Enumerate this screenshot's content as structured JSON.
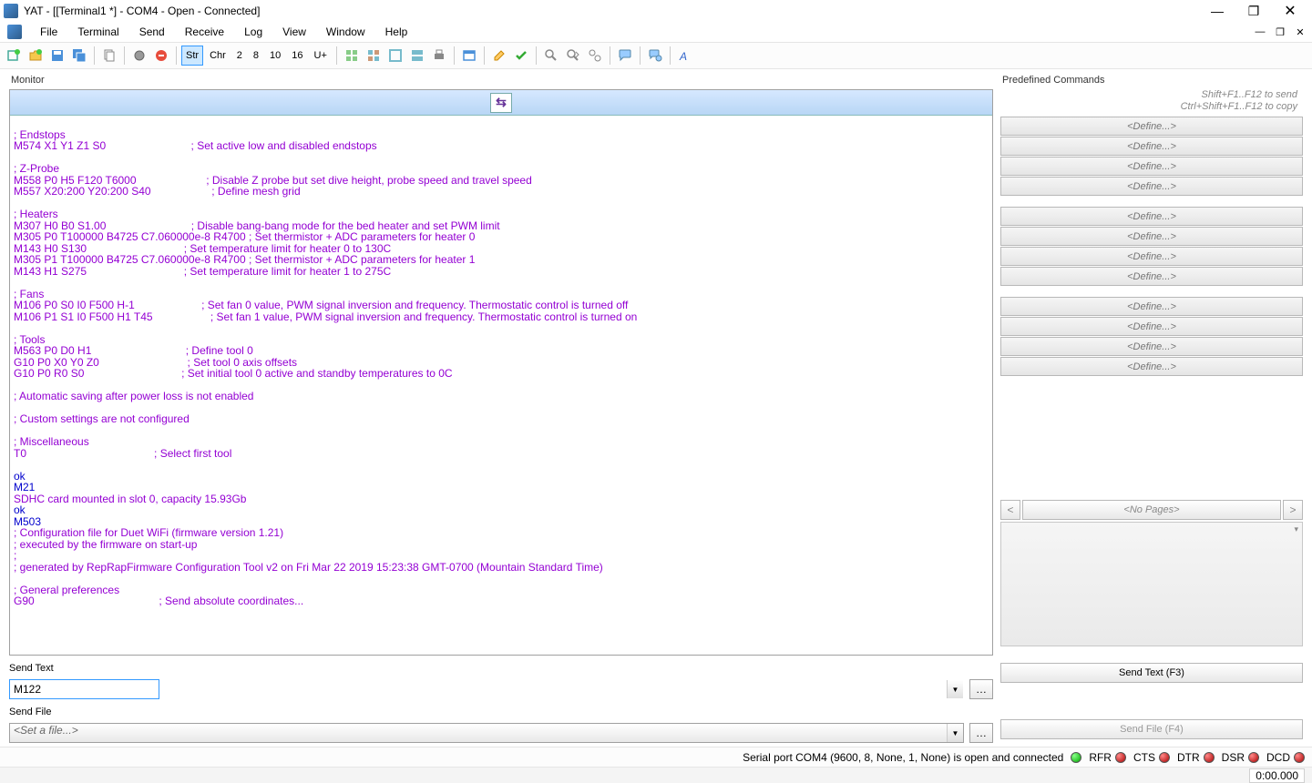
{
  "window": {
    "title": "YAT - [[Terminal1 *] - COM4 - Open - Connected]"
  },
  "menu": {
    "items": [
      "File",
      "Terminal",
      "Send",
      "Receive",
      "Log",
      "View",
      "Window",
      "Help"
    ]
  },
  "toolbar": {
    "radix": {
      "str": "Str",
      "chr": "Chr",
      "r2": "2",
      "r8": "8",
      "r10": "10",
      "r16": "16",
      "uplus": "U+"
    }
  },
  "monitor": {
    "label": "Monitor",
    "lines": [
      {
        "c": "p",
        "t": ""
      },
      {
        "c": "p",
        "t": "; Endstops"
      },
      {
        "c": "p",
        "t": "M574 X1 Y1 Z1 S0                            ; Set active low and disabled endstops"
      },
      {
        "c": "p",
        "t": ""
      },
      {
        "c": "p",
        "t": "; Z-Probe"
      },
      {
        "c": "p",
        "t": "M558 P0 H5 F120 T6000                       ; Disable Z probe but set dive height, probe speed and travel speed"
      },
      {
        "c": "p",
        "t": "M557 X20:200 Y20:200 S40                    ; Define mesh grid"
      },
      {
        "c": "p",
        "t": ""
      },
      {
        "c": "p",
        "t": "; Heaters"
      },
      {
        "c": "p",
        "t": "M307 H0 B0 S1.00                            ; Disable bang-bang mode for the bed heater and set PWM limit"
      },
      {
        "c": "p",
        "t": "M305 P0 T100000 B4725 C7.060000e-8 R4700 ; Set thermistor + ADC parameters for heater 0"
      },
      {
        "c": "p",
        "t": "M143 H0 S130                                ; Set temperature limit for heater 0 to 130C"
      },
      {
        "c": "p",
        "t": "M305 P1 T100000 B4725 C7.060000e-8 R4700 ; Set thermistor + ADC parameters for heater 1"
      },
      {
        "c": "p",
        "t": "M143 H1 S275                                ; Set temperature limit for heater 1 to 275C"
      },
      {
        "c": "p",
        "t": ""
      },
      {
        "c": "p",
        "t": "; Fans"
      },
      {
        "c": "p",
        "t": "M106 P0 S0 I0 F500 H-1                      ; Set fan 0 value, PWM signal inversion and frequency. Thermostatic control is turned off"
      },
      {
        "c": "p",
        "t": "M106 P1 S1 I0 F500 H1 T45                   ; Set fan 1 value, PWM signal inversion and frequency. Thermostatic control is turned on"
      },
      {
        "c": "p",
        "t": ""
      },
      {
        "c": "p",
        "t": "; Tools"
      },
      {
        "c": "p",
        "t": "M563 P0 D0 H1                               ; Define tool 0"
      },
      {
        "c": "p",
        "t": "G10 P0 X0 Y0 Z0                             ; Set tool 0 axis offsets"
      },
      {
        "c": "p",
        "t": "G10 P0 R0 S0                                ; Set initial tool 0 active and standby temperatures to 0C"
      },
      {
        "c": "p",
        "t": ""
      },
      {
        "c": "p",
        "t": "; Automatic saving after power loss is not enabled"
      },
      {
        "c": "p",
        "t": ""
      },
      {
        "c": "p",
        "t": "; Custom settings are not configured"
      },
      {
        "c": "p",
        "t": ""
      },
      {
        "c": "p",
        "t": "; Miscellaneous"
      },
      {
        "c": "p",
        "t": "T0                                          ; Select first tool"
      },
      {
        "c": "p",
        "t": ""
      },
      {
        "c": "ok",
        "t": "ok"
      },
      {
        "c": "cmd",
        "t": "M21"
      },
      {
        "c": "p",
        "t": "SDHC card mounted in slot 0, capacity 15.93Gb"
      },
      {
        "c": "ok",
        "t": "ok"
      },
      {
        "c": "cmd",
        "t": "M503"
      },
      {
        "c": "p",
        "t": "; Configuration file for Duet WiFi (firmware version 1.21)"
      },
      {
        "c": "p",
        "t": "; executed by the firmware on start-up"
      },
      {
        "c": "p",
        "t": ";"
      },
      {
        "c": "p",
        "t": "; generated by RepRapFirmware Configuration Tool v2 on Fri Mar 22 2019 15:23:38 GMT-0700 (Mountain Standard Time)"
      },
      {
        "c": "p",
        "t": ""
      },
      {
        "c": "p",
        "t": "; General preferences"
      },
      {
        "c": "p",
        "t": "G90                                         ; Send absolute coordinates..."
      }
    ]
  },
  "sendText": {
    "label": "Send Text",
    "value": "M122",
    "button": "Send Text (F3)"
  },
  "sendFile": {
    "label": "Send File",
    "placeholder": "<Set a file...>",
    "button": "Send File (F4)"
  },
  "predefined": {
    "label": "Predefined Commands",
    "hint1": "Shift+F1..F12 to send",
    "hint2": "Ctrl+Shift+F1..F12 to copy",
    "btn": "<Define...>",
    "noPages": "<No Pages>"
  },
  "status": {
    "text": "Serial port COM4 (9600, 8, None, 1, None) is open and connected",
    "leds": [
      {
        "name": "conn",
        "color": "green",
        "label": ""
      },
      {
        "name": "rfr",
        "color": "red",
        "label": "RFR"
      },
      {
        "name": "cts",
        "color": "red",
        "label": "CTS"
      },
      {
        "name": "dtr",
        "color": "red",
        "label": "DTR"
      },
      {
        "name": "dsr",
        "color": "red",
        "label": "DSR"
      },
      {
        "name": "dcd",
        "color": "red",
        "label": "DCD"
      }
    ]
  },
  "time": "0:00.000"
}
